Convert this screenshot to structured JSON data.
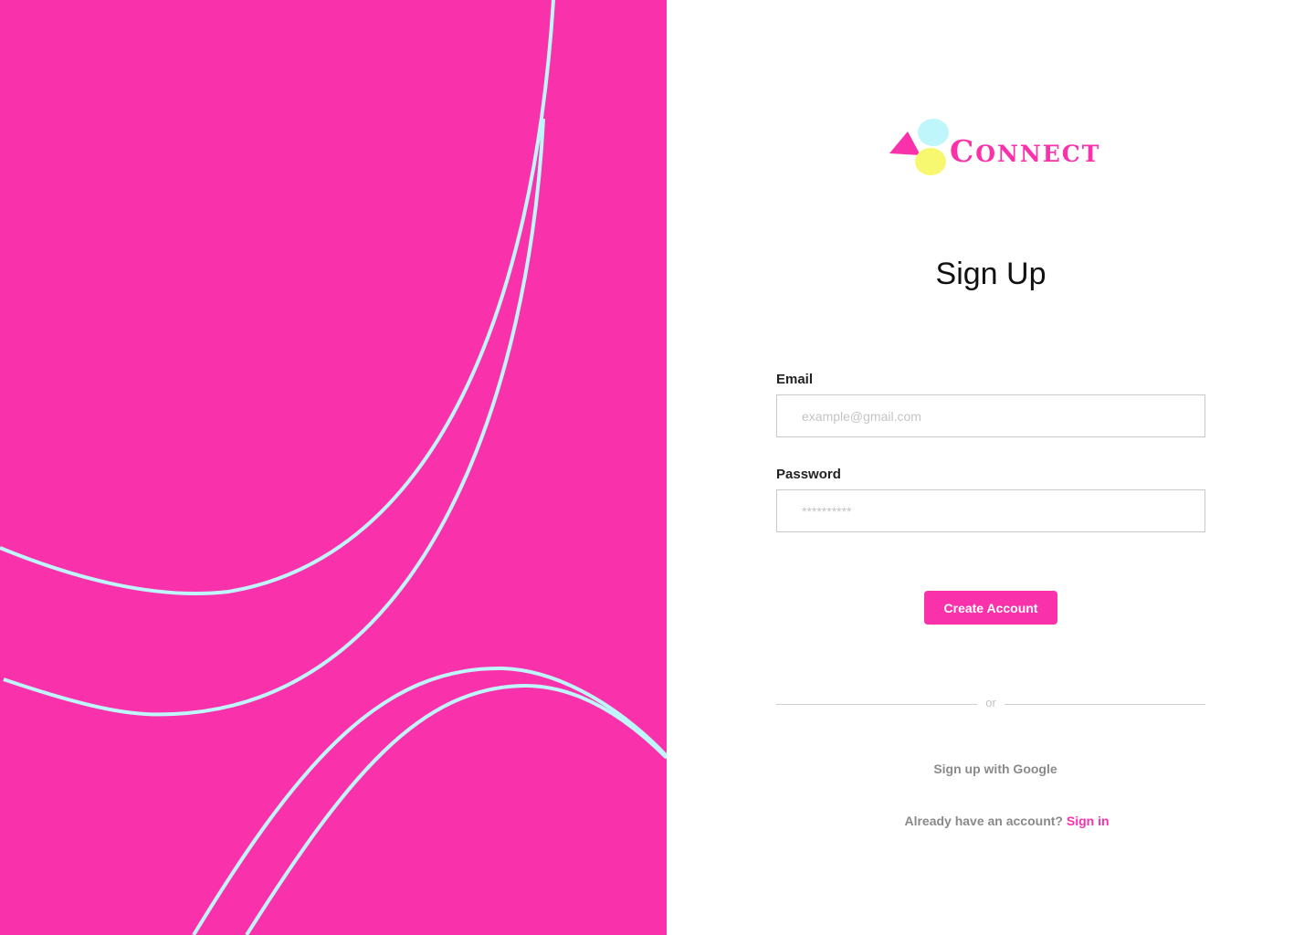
{
  "brand": {
    "name_initial": "C",
    "name_rest": "ONNECT",
    "primary_color": "#f932ab",
    "accent_cyan": "#bff6fb",
    "accent_yellow": "#f8f870"
  },
  "form": {
    "title": "Sign Up",
    "email": {
      "label": "Email",
      "placeholder": "example@gmail.com",
      "value": ""
    },
    "password": {
      "label": "Password",
      "placeholder": "**********",
      "value": ""
    },
    "submit_label": "Create Account",
    "divider_text": "or",
    "google_label": "Sign up with Google",
    "signin_prompt": "Already have an account?",
    "signin_label": "Sign in"
  }
}
